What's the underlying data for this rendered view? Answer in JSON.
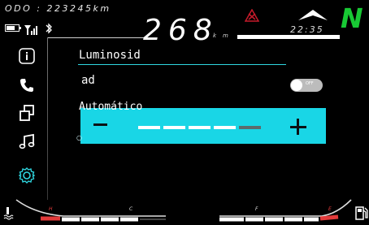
{
  "odometer": "ODO : 223245km",
  "speed": "268",
  "speed_unit": "km",
  "clock": "22:35",
  "gear": "N",
  "colors": {
    "gear": "#18c934",
    "accent": "#19d6e6",
    "warning": "#e23a3a"
  },
  "status_icons": [
    "battery-icon",
    "signal-icon",
    "bluetooth-icon",
    "warning-triangle-icon",
    "navigation-arrow-icon"
  ],
  "sidebar": {
    "items": [
      {
        "name": "info-icon"
      },
      {
        "name": "phone-icon"
      },
      {
        "name": "swap-icon"
      },
      {
        "name": "music-icon"
      },
      {
        "name": "settings-icon"
      }
    ]
  },
  "menu": {
    "title": "Luminosid",
    "subtitle": "ad",
    "toggle_label": "OFF",
    "brightness_label": "Automático",
    "brightness_level": 0.8,
    "segments_total": 5,
    "segments_filled": 4
  },
  "gauges": {
    "temp": {
      "low": "C",
      "high": "H"
    },
    "fuel": {
      "low": "F",
      "high": "E"
    }
  }
}
